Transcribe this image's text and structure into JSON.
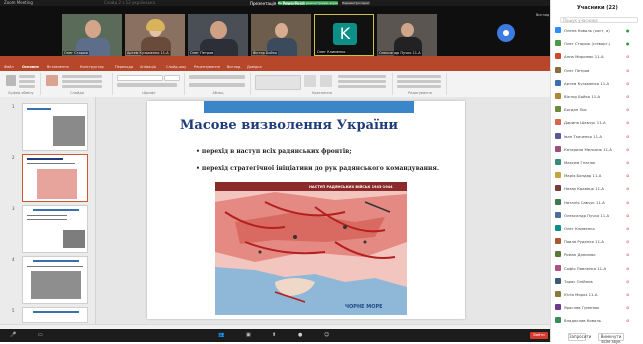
{
  "zoom": {
    "window_title": "Zoom Meeting",
    "share_banner": "Ви переглядаєте демонстрацію екрана",
    "view_options": "Параметри перегляду",
    "view_button": "Вигляд",
    "video_tiles": [
      {
        "name": "Олег Сторож"
      },
      {
        "name": "Артем Кузьменко 11-А"
      },
      {
        "name": "Олег Петров"
      },
      {
        "name": "Віктор Бойко"
      },
      {
        "name": "Олег Клименко",
        "initial": "K"
      },
      {
        "name": "Олександр Пучко 11-А"
      }
    ],
    "controls": [
      "Вимк. звук",
      "Почати відео",
      "Учасники",
      "Чат",
      "Демонстрація",
      "Запис",
      "Реакції"
    ],
    "end_label": "Вийти"
  },
  "powerpoint": {
    "title": "Презентація — PowerPoint",
    "tabs": [
      "Файл",
      "Основне",
      "Вставлення",
      "Конструктор",
      "Переходи",
      "Анімація",
      "Слайд-шоу",
      "Рецензування",
      "Вигляд",
      "Довідка"
    ],
    "groups": [
      "Буфер обміну",
      "Слайди",
      "Шрифт",
      "Абзац",
      "Креслення",
      "Редагування"
    ],
    "status": "Слайд 2 з 12   українська",
    "thumbnail_numbers": [
      "1",
      "2",
      "3",
      "4",
      "5"
    ]
  },
  "slide": {
    "title": "Масове визволення України",
    "bullets": [
      "• перехід в наступ всіх радянських фронтів;",
      "• перехід стратегічної ініціативи до рук радянського командування."
    ],
    "map_title": "НАСТУП РАДЯНСЬКИХ ВІЙСЬК 1943-1944",
    "map_sea_label": "ЧОРНЕ МОРЕ"
  },
  "participants": {
    "title": "Учасники (22)",
    "search_placeholder": "Пошук учасника",
    "list": [
      {
        "name": "Олена Коваль (хост, я)",
        "color": "#2d8cff",
        "mic": "on"
      },
      {
        "name": "Олег Сторож (співорг.)",
        "color": "#4c9a46",
        "mic": "on"
      },
      {
        "name": "Анна Миронюк 11-А",
        "color": "#c94f2a",
        "mic": "off"
      },
      {
        "name": "Олег Петров",
        "color": "#8a6d3b",
        "mic": "off"
      },
      {
        "name": "Артем Кузьменко 11-А",
        "color": "#3b6fb0",
        "mic": "off"
      },
      {
        "name": "Віктор Бойко 11-А",
        "color": "#b0853b",
        "mic": "off"
      },
      {
        "name": "Богдан Лис",
        "color": "#6d8a3b",
        "mic": "off"
      },
      {
        "name": "Дарина Шевчук 11-А",
        "color": "#d06a4a",
        "mic": "off"
      },
      {
        "name": "Іван Ткаченко 11-А",
        "color": "#5a5a9a",
        "mic": "off"
      },
      {
        "name": "Катерина Мельник 11-А",
        "color": "#9a4f7a",
        "mic": "off"
      },
      {
        "name": "Максим Гнатюк",
        "color": "#3a8a7a",
        "mic": "off"
      },
      {
        "name": "Марія Бондар 11-А",
        "color": "#c4a43b",
        "mic": "off"
      },
      {
        "name": "Назар Кравець 11-А",
        "color": "#7a3b3b",
        "mic": "off"
      },
      {
        "name": "Наталія Савчук 11-А",
        "color": "#3b7a4f",
        "mic": "off"
      },
      {
        "name": "Олександр Пучко 11-А",
        "color": "#4f6d9a",
        "mic": "off"
      },
      {
        "name": "Олег Клименко",
        "color": "#0c8f86",
        "mic": "off"
      },
      {
        "name": "Павло Руденко 11-А",
        "color": "#a85a2a",
        "mic": "off"
      },
      {
        "name": "Роман Данилюк",
        "color": "#5a7a3b",
        "mic": "off"
      },
      {
        "name": "Софія Павленко 11-А",
        "color": "#b04f8a",
        "mic": "off"
      },
      {
        "name": "Тарас Олійник",
        "color": "#3b5a7a",
        "mic": "off"
      },
      {
        "name": "Юлія Мороз 11-А",
        "color": "#8a7a3b",
        "mic": "off"
      },
      {
        "name": "Ярослав Гуменюк",
        "color": "#6a3b8a",
        "mic": "off"
      },
      {
        "name": "Владислав Коваль",
        "color": "#3b8a5a",
        "mic": "off"
      }
    ],
    "invite_button": "Запросити",
    "mute_all_button": "Вимкнути всім звук"
  }
}
